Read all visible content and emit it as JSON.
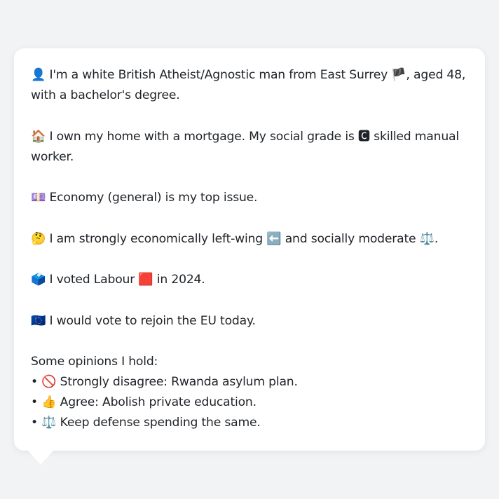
{
  "profile": {
    "identity": {
      "icon": "👤",
      "text_a": " I'm a white British Atheist/Agnostic man from East Surrey ",
      "flag": "🏴",
      "text_b": ", aged 48, with a bachelor's degree."
    },
    "home": {
      "icon": "🏠",
      "text_a": " I own my home with a mortgage. My social grade is ",
      "grade_icon": "🅲",
      "text_b": " skilled manual worker."
    },
    "issue": {
      "icon": "💷",
      "text": " Economy (general) is my top issue."
    },
    "ideology": {
      "icon": "🤔",
      "text_a": " I am strongly economically left-wing ",
      "left_icon": "⬅️",
      "text_b": " and socially moderate ",
      "scale_icon": "⚖️",
      "text_c": "."
    },
    "vote": {
      "icon": "🗳️",
      "text_a": " I voted Labour ",
      "party_icon": "🟥",
      "text_b": " in 2024."
    },
    "eu": {
      "icon": "🇪🇺",
      "text": " I would vote to rejoin the EU today."
    },
    "opinions": {
      "heading": "Some opinions I hold:",
      "items": [
        {
          "bullet": "• ",
          "icon": "🚫",
          "text": " Strongly disagree: Rwanda asylum plan."
        },
        {
          "bullet": "• ",
          "icon": "👍",
          "text": " Agree: Abolish private education."
        },
        {
          "bullet": "• ",
          "icon": "⚖️",
          "text": " Keep defense spending the same."
        }
      ]
    }
  }
}
